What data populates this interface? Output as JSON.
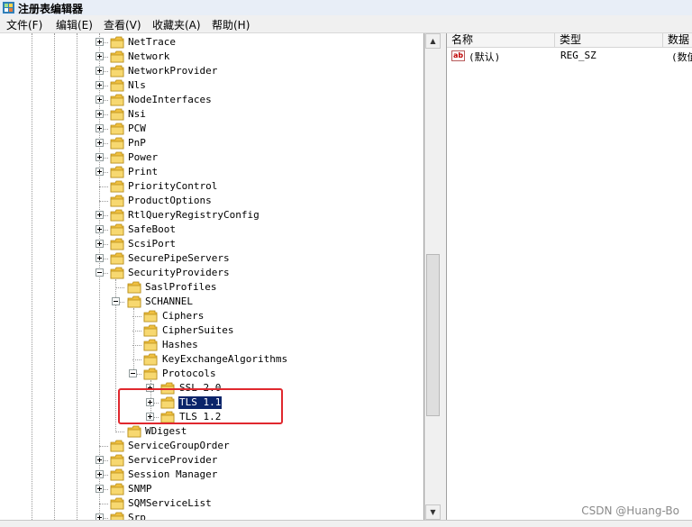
{
  "window": {
    "title": "注册表编辑器",
    "icon": "regedit-icon"
  },
  "menu": [
    "文件(F)",
    "编辑(E)",
    "查看(V)",
    "收藏夹(A)",
    "帮助(H)"
  ],
  "tree": {
    "rows": [
      {
        "label": "NetTrace",
        "toggle": "plus"
      },
      {
        "label": "Network",
        "toggle": "plus"
      },
      {
        "label": "NetworkProvider",
        "toggle": "plus"
      },
      {
        "label": "Nls",
        "toggle": "plus"
      },
      {
        "label": "NodeInterfaces",
        "toggle": "plus"
      },
      {
        "label": "Nsi",
        "toggle": "plus"
      },
      {
        "label": "PCW",
        "toggle": "plus"
      },
      {
        "label": "PnP",
        "toggle": "plus"
      },
      {
        "label": "Power",
        "toggle": "plus"
      },
      {
        "label": "Print",
        "toggle": "plus"
      },
      {
        "label": "PriorityControl",
        "toggle": "none"
      },
      {
        "label": "ProductOptions",
        "toggle": "none"
      },
      {
        "label": "RtlQueryRegistryConfig",
        "toggle": "plus"
      },
      {
        "label": "SafeBoot",
        "toggle": "plus"
      },
      {
        "label": "ScsiPort",
        "toggle": "plus"
      },
      {
        "label": "SecurePipeServers",
        "toggle": "plus"
      },
      {
        "label": "SecurityProviders",
        "toggle": "minus"
      },
      {
        "label": "SaslProfiles",
        "toggle": "none"
      },
      {
        "label": "SCHANNEL",
        "toggle": "minus"
      },
      {
        "label": "Ciphers",
        "toggle": "none"
      },
      {
        "label": "CipherSuites",
        "toggle": "none"
      },
      {
        "label": "Hashes",
        "toggle": "none"
      },
      {
        "label": "KeyExchangeAlgorithms",
        "toggle": "none"
      },
      {
        "label": "Protocols",
        "toggle": "minus"
      },
      {
        "label": "SSL 2.0",
        "toggle": "plus"
      },
      {
        "label": "TLS 1.1",
        "toggle": "plus",
        "selected": true
      },
      {
        "label": "TLS 1.2",
        "toggle": "plus"
      },
      {
        "label": "WDigest",
        "toggle": "none"
      },
      {
        "label": "ServiceGroupOrder",
        "toggle": "none"
      },
      {
        "label": "ServiceProvider",
        "toggle": "plus"
      },
      {
        "label": "Session Manager",
        "toggle": "plus"
      },
      {
        "label": "SNMP",
        "toggle": "plus"
      },
      {
        "label": "SQMServiceList",
        "toggle": "none"
      },
      {
        "label": "Srp",
        "toggle": "plus"
      }
    ]
  },
  "values": {
    "columns": [
      "名称",
      "类型",
      "数据"
    ],
    "rows": [
      {
        "name": "(默认)",
        "type": "REG_SZ",
        "data": "(数值"
      }
    ]
  },
  "watermark": "CSDN @Huang-Bo",
  "colors": {
    "selection": "#0a246a",
    "highlight_box": "#e0282e",
    "folder": "#f0c040"
  }
}
